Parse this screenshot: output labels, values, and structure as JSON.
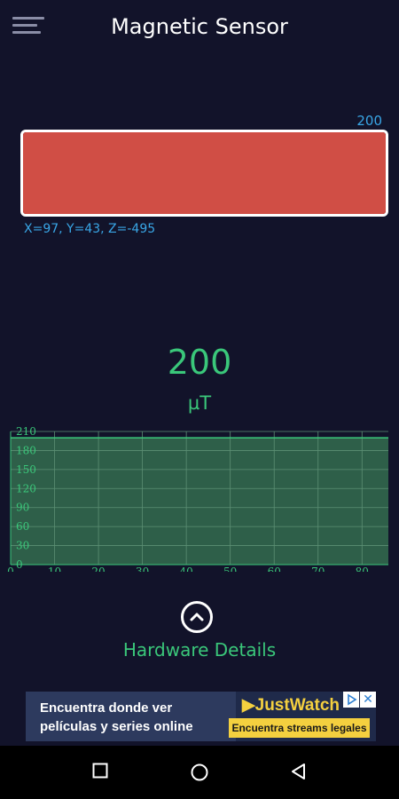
{
  "app": {
    "title": "Magnetic Sensor"
  },
  "icons": {
    "menu": "hamburger-menu-icon",
    "chevron": "chevron-up-icon",
    "back": "triangle-back-icon",
    "home": "circle-home-icon",
    "recents": "square-recents-icon"
  },
  "colors": {
    "background": "#12132a",
    "accent_green": "#3ac77a",
    "accent_blue": "#39a6e6",
    "bar_red": "#d04e45"
  },
  "bar": {
    "max_label": "200",
    "level": 1.0,
    "axes_text": "X=97, Y=43, Z=-495"
  },
  "reading": {
    "value": "200",
    "unit": "µT"
  },
  "chart_data": {
    "type": "area",
    "y_ticks": [
      "210",
      "180",
      "150",
      "120",
      "90",
      "60",
      "30",
      "0"
    ],
    "x_ticks": [
      "0",
      "10",
      "20",
      "30",
      "40",
      "50",
      "60",
      "70",
      "80"
    ],
    "ylim": [
      0,
      210
    ],
    "xlim": [
      0,
      86
    ],
    "x": [
      0,
      86
    ],
    "values": [
      200,
      200
    ],
    "grid": true,
    "fill_color": "#2e5f49",
    "line_color": "#3ac77a"
  },
  "hardware": {
    "label": "Hardware Details"
  },
  "ad": {
    "line1": "Encuentra donde ver",
    "line2": "películas y series online",
    "brand": "JustWatch",
    "cta": "Encuentra streams legales",
    "close": "✕"
  }
}
